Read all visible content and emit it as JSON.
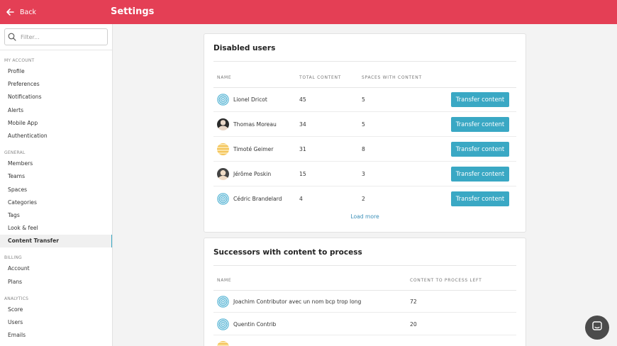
{
  "header": {
    "back_label": "Back",
    "title": "Settings"
  },
  "sidebar": {
    "filter_placeholder": "Filter...",
    "sections": [
      {
        "title": "MY ACCOUNT",
        "items": [
          "Profile",
          "Preferences",
          "Notifications",
          "Alerts",
          "Mobile App",
          "Authentication"
        ]
      },
      {
        "title": "GENERAL",
        "items": [
          "Members",
          "Teams",
          "Spaces",
          "Categories",
          "Tags",
          "Look & feel",
          "Content Transfer"
        ]
      },
      {
        "title": "BILLING",
        "items": [
          "Account",
          "Plans"
        ]
      },
      {
        "title": "ANALYTICS",
        "items": [
          "Score",
          "Users",
          "Emails"
        ]
      }
    ],
    "active_item": "Content Transfer"
  },
  "disabled_users": {
    "title": "Disabled users",
    "columns": [
      "NAME",
      "TOTAL CONTENT",
      "SPACES WITH CONTENT"
    ],
    "action_label": "Transfer content",
    "rows": [
      {
        "name": "Lionel Dricot",
        "total": "45",
        "spaces": "5",
        "avatar": "pattern-avatar"
      },
      {
        "name": "Thomas Moreau",
        "total": "34",
        "spaces": "5",
        "avatar": "photo-avatar"
      },
      {
        "name": "Timoté Geimer",
        "total": "31",
        "spaces": "8",
        "avatar": "yellow-avatar"
      },
      {
        "name": "Jérôme Poskin",
        "total": "15",
        "spaces": "3",
        "avatar": "photo-avatar"
      },
      {
        "name": "Cédric Brandelard",
        "total": "4",
        "spaces": "2",
        "avatar": "pattern-avatar"
      }
    ],
    "load_more": "Load more"
  },
  "successors": {
    "title": "Successors with content to process",
    "columns": [
      "NAME",
      "CONTENT TO PROCESS LEFT"
    ],
    "rows": [
      {
        "name": "Joachim Contributor avec un nom bcp trop long",
        "left": "72",
        "avatar": "pattern-avatar"
      },
      {
        "name": "Quentin Contrib",
        "left": "20",
        "avatar": "pattern-avatar"
      }
    ]
  },
  "colors": {
    "accent": "#e43f55",
    "button": "#3aa8c4",
    "link": "#3a8fb8"
  }
}
